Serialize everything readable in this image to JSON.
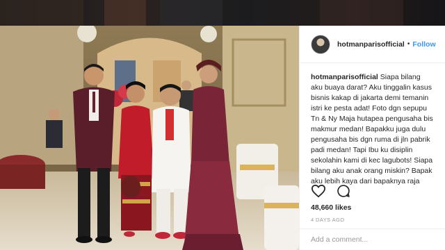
{
  "post": {
    "username": "hotmanparisofficial",
    "separator": "•",
    "follow_label": "Follow",
    "caption_user": "hotmanparisofficial",
    "caption_text": "Siapa bilang aku buaya darat? Aku tinggalin kasus bisnis kakap di jakarta demi temanin istri ke pesta adat! Foto dgn sepupu Tn & Ny Maja hutapea pengusaha bis makmur medan! Bapakku juga dulu pengusaha bis dgn ruma di jln pabrik padi medan! Tapi Ibu ku disiplin sekolahin kami di kec lagubots! Siapa bilang aku anak orang miskin? Bapak aku lebih kaya dari bapaknya raja minyak! Bapakku pendiri bis bintang utara, bis c itoh , bis martimbang dll bahkan ikut di bis makmur!",
    "likes": "48,660 likes",
    "date": "4 DAYS AGO",
    "comment_placeholder": "Add a comment..."
  },
  "icons": {
    "like": "heart-icon",
    "comment": "speech-bubble-icon",
    "avatar": "profile-avatar"
  },
  "colors": {
    "link_blue": "#3897f0",
    "text": "#262626",
    "muted": "#999999"
  }
}
